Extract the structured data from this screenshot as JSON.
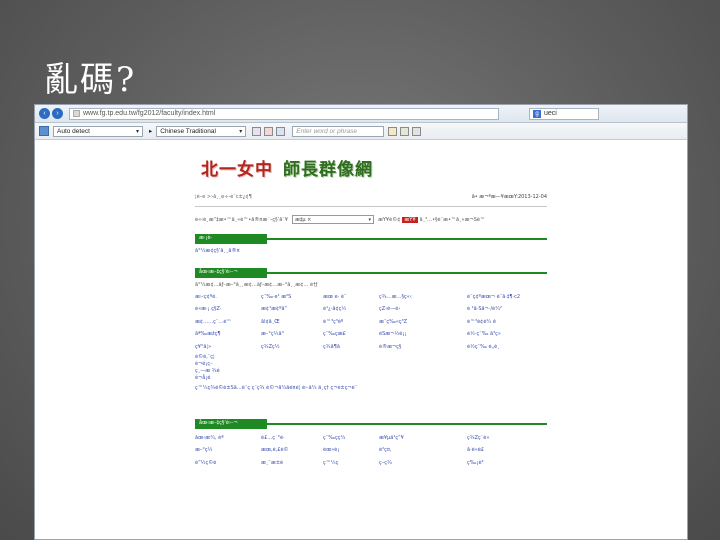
{
  "slide": {
    "title": "亂碼?"
  },
  "browser": {
    "url": "www.fg.tp.edu.tw/fg2012/faculty/index.html",
    "search": "ueci",
    "search_engine_icon": "google-icon",
    "detect_select": "Auto detect",
    "language_select": "Chinese Traditional",
    "word_placeholder": "Enter word or phrase"
  },
  "site": {
    "title_main": "北一女中",
    "title_sub": "師長群像網",
    "breadcrumb": "¦é–e >›å¸¸e÷-é¨c±¿¢¶",
    "date_prefix": "å• æ¬ªæ—¥æœŸ:",
    "date": "2013-12-04",
    "filter_label": "è«‹é¸æ“‡æ•™å¸«è™•å®¤æˆ–ç§‘åˆ¥",
    "filter_select": "æ‡µ ×",
    "filter_btn_prefix": "æŸ¥è©¢",
    "filter_btn": "æŸ¥",
    "filter_suffix": "å¸³…•§è¨­æ•™å¸«æ¬Šé™",
    "section1_tab": "æ·¡è­·",
    "section1_line": "å°¼æ¢ç§‘å¸¸å®¤",
    "section2_tab": "åœ‹æ–‡ç§‘é›–¬",
    "section2_line": "å°¼æ¢…ãƒ–æ–°å¸¸æ¢…ãƒ–æ¢…æ–°å¸¸æ¢… è†ƒ",
    "row_a": [
      "æ›‹ç¢ºé.",
      "ç¯‰·e¹ æ²Š",
      "æœ e· é¯",
      "ç¾…æ…§ç«‹",
      "è¨ç¢ºæœ¬ è¯å·‡¶·c2"
    ],
    "row_b": [
      "é«æ·¡ ç§Ž·",
      "æ¢¹æ¢ºå“",
      "é¹¿·å¢ç½",
      "çŽ‹è—é›",
      "é ¹å·Šå¬·/é¼²"
    ],
    "row_c": [
      "æ¢……ç¨…é™",
      "ål¢å¸Œ",
      "é™³ç³éº",
      "æ¯ç‰«ç³Ž",
      "é™³é¢é¼ ê"
    ],
    "row_d": [
      "åª‰æžç¶",
      "æ–°ç½å°",
      "ç¯‰ç­æ£",
      "èŠæ¬½è¡¡",
      "é½·ç¯‰ å³ç»"
    ],
    "row_e": [
      "ç¥°å¦»",
      "ç¾Žç½",
      "ç¾å¶å",
      "é®æ¬ç§",
      "é½ç¯‰ é„è¸"
    ],
    "stack_a": "é©é‚¨ç¦",
    "stack_b": "è¬é¡ç–",
    "stack_c": "ç¸—æ ¾é",
    "stack_d": "è¬å¡é",
    "long_line": "ç™¼ç¾é©è±Šå…è¯ç ç¨ç¾ é©¬å¼åé¤é¦ é›·ä¼ ä¸ç† ç¬è±ç¬è¯",
    "row_f": [
      "åœ‹æ¼‚ èª",
      "è£…ç´°è­·",
      "ç¯‰çç¼",
      "æ¥µä¹ç”¥",
      "ç¾Žçˆé»"
    ],
    "row_g": [
      "æ–°ç½",
      "æœ‚é‚£é©",
      "èœ»è¡",
      "é²ç¤‚",
      "å·é«è£"
    ],
    "row_h": [
      "é”½ç©é",
      "æ¸¯æ±é",
      "ç™¼ç",
      "ç–ç¾",
      "ç‰¡è³"
    ]
  }
}
